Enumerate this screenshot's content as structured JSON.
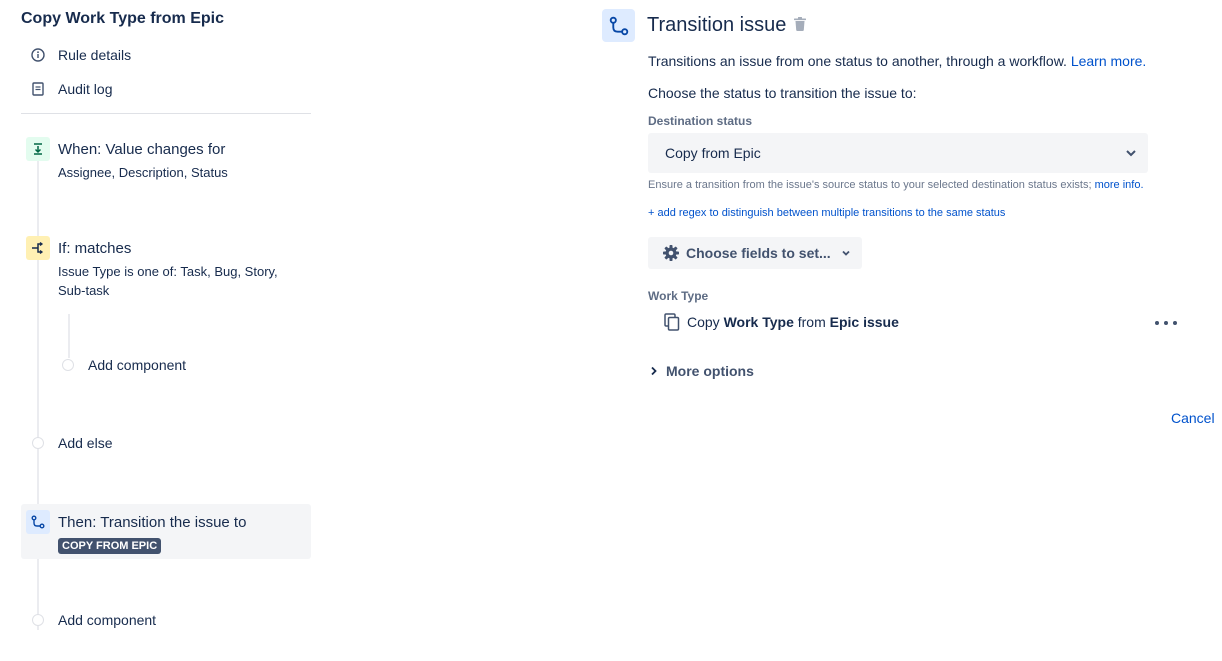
{
  "sidebar": {
    "rule_title": "Copy Work Type from Epic",
    "nav": {
      "rule_details": "Rule details",
      "audit_log": "Audit log"
    },
    "trigger": {
      "title": "When: Value changes for",
      "subtitle": "Assignee, Description, Status",
      "icon": "value-changes-icon"
    },
    "condition": {
      "title": "If: matches",
      "subtitle": "Issue Type is one of: Task, Bug, Story, Sub-task",
      "icon": "branch-icon",
      "add_component": "Add component"
    },
    "add_else": "Add else",
    "action": {
      "title": "Then: Transition the issue to",
      "lozenge": "COPY FROM EPIC",
      "icon": "transition-icon"
    },
    "add_component": "Add component"
  },
  "panel": {
    "title": "Transition issue",
    "description": "Transitions an issue from one status to another, through a workflow.",
    "learn_more": "Learn more.",
    "choose_label": "Choose the status to transition the issue to:",
    "destination_label": "Destination status",
    "destination_value": "Copy from Epic",
    "helper_text": "Ensure a transition from the issue's source status to your selected destination status exists;",
    "more_info": "more info.",
    "regex_link": "+ add regex to distinguish between multiple transitions to the same status",
    "choose_fields": "Choose fields to set...",
    "work_type_label": "Work Type",
    "work_type_row": {
      "prefix": "Copy",
      "field": "Work Type",
      "middle": "from",
      "source": "Epic issue"
    },
    "more_options": "More options",
    "cancel": "Cancel"
  },
  "colors": {
    "link": "#0052cc",
    "text": "#172b4d",
    "lozenge_bg": "#42526e",
    "trigger_bg": "#e3fcef",
    "condition_bg": "#fff0b3",
    "action_bg": "#deebff"
  }
}
